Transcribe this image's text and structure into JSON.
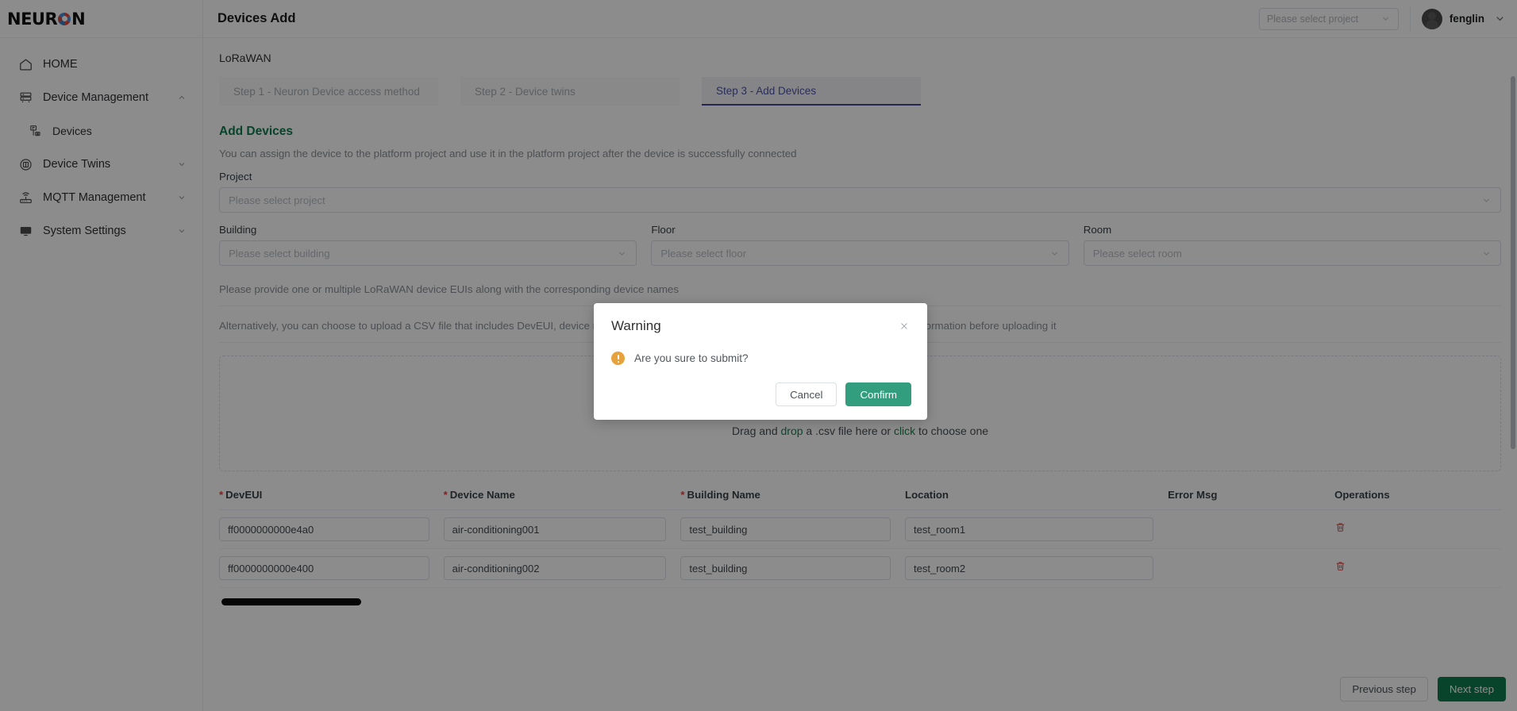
{
  "brand": {
    "logo_text_before": "NEUR",
    "logo_text_after": "N",
    "logo_o_icon": "neuron-o-logo-icon"
  },
  "sidebar": {
    "items": [
      {
        "label": "HOME",
        "icon": "home-icon",
        "chevron": "none",
        "sub": false
      },
      {
        "label": "Device Management",
        "icon": "device-management-icon",
        "chevron": "up",
        "sub": false
      },
      {
        "label": "Devices",
        "icon": "devices-icon",
        "chevron": "none",
        "sub": true
      },
      {
        "label": "Device Twins",
        "icon": "device-twins-icon",
        "chevron": "down",
        "sub": false
      },
      {
        "label": "MQTT Management",
        "icon": "mqtt-router-icon",
        "chevron": "down",
        "sub": false
      },
      {
        "label": "System Settings",
        "icon": "system-settings-icon",
        "chevron": "down",
        "sub": false
      }
    ]
  },
  "header": {
    "title": "Devices Add",
    "project_select_placeholder": "Please select project",
    "project_select_value": "",
    "user_name": "fenglin",
    "avatar_icon": "user-avatar",
    "chevron_icon": "chevron-down-icon"
  },
  "content": {
    "kind_label": "LoRaWAN",
    "steps": [
      {
        "label": "Step 1 - Neuron Device access method",
        "active": false
      },
      {
        "label": "Step 2 - Device twins",
        "active": false
      },
      {
        "label": "Step 3 - Add Devices",
        "active": true
      }
    ],
    "section_title": "Add Devices",
    "section_desc": "You can assign the device to the platform project and use it in the platform project after the device is successfully connected",
    "project_label": "Project",
    "project_placeholder": "Please select project",
    "building_label": "Building",
    "building_placeholder": "Please select building",
    "floor_label": "Floor",
    "floor_placeholder": "Please select floor",
    "room_label": "Room",
    "room_placeholder": "Please select room",
    "hint_1": "Please provide one or multiple LoRaWAN device EUIs along with the corresponding device names",
    "hint_2": "Alternatively, you can choose to upload a CSV file that includes DevEUI, device name and location, download the CSV template and fill in the device information before uploading it",
    "dropzone": {
      "icon": "cloud-upload-icon",
      "text_a": "Drag and ",
      "link_a": "drop",
      "text_b": " a .csv file here or ",
      "link_b": "click",
      "text_c": " to choose one"
    }
  },
  "table": {
    "columns": [
      {
        "label": "DevEUI",
        "required": true
      },
      {
        "label": "Device Name",
        "required": true
      },
      {
        "label": "Building Name",
        "required": true
      },
      {
        "label": "Location",
        "required": false
      },
      {
        "label": "Error Msg",
        "required": false
      },
      {
        "label": "Operations",
        "required": false
      }
    ],
    "rows": [
      {
        "deveui": "ff0000000000e4a0",
        "device_name": "air-conditioning001",
        "building_name": "test_building",
        "location": "test_room1",
        "error_msg": "",
        "delete_icon": "trash-icon"
      },
      {
        "deveui": "ff0000000000e400",
        "device_name": "air-conditioning002",
        "building_name": "test_building",
        "location": "test_room2",
        "error_msg": "",
        "delete_icon": "trash-icon"
      }
    ]
  },
  "footer": {
    "previous_label": "Previous step",
    "next_label": "Next step"
  },
  "modal": {
    "title": "Warning",
    "message": "Are you sure to submit?",
    "cancel_label": "Cancel",
    "confirm_label": "Confirm",
    "close_icon": "close-icon",
    "warning_icon": "warning-circle-icon"
  },
  "colors": {
    "brand_green": "#0f7b4f",
    "confirm_green": "#339e7d",
    "warning_orange": "#e6a23c",
    "required_red": "#e8413c",
    "active_step_blue": "#4c52a8"
  }
}
